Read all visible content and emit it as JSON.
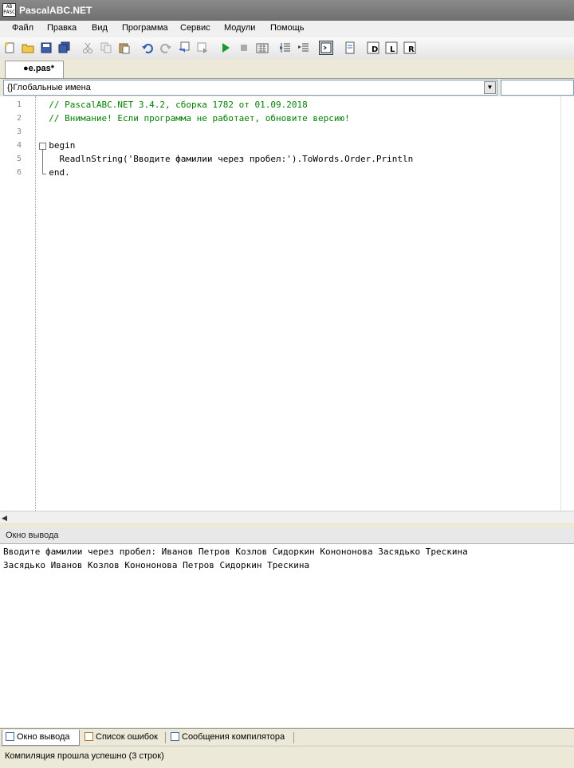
{
  "window": {
    "title": "PascalABC.NET",
    "icon_text": "AB PASC"
  },
  "menu": [
    "Файл",
    "Правка",
    "Вид",
    "Программа",
    "Сервис",
    "Модули",
    "Помощь"
  ],
  "tab": {
    "label": "●e.pas*"
  },
  "scope_selector": {
    "value": "{}Глобальные имена"
  },
  "editor": {
    "line_numbers": [
      "1",
      "2",
      "3",
      "4",
      "5",
      "6"
    ],
    "lines": [
      "  // PascalABC.NET 3.4.2, сборка 1782 от 01.09.2018",
      "  // Внимание! Если программа не работает, обновите версию!",
      "",
      "  begin",
      "    ReadlnString('Вводите фамилии через пробел:').ToWords.Order.Println",
      "  end."
    ]
  },
  "output_panel": {
    "title": "Окно вывода",
    "lines": [
      "Вводите фамилии через пробел: Иванов Петров Козлов Сидоркин Конононова Засядько Трескина",
      "Засядько Иванов Козлов Конононова Петров Сидоркин Трескина"
    ]
  },
  "bottom_tabs": [
    "Окно вывода",
    "Список ошибок",
    "Сообщения компилятора"
  ],
  "status": {
    "text": "Компиляция прошла успешно (3 строк)"
  },
  "colors": {
    "comment": "#008000",
    "title_bar": "#7a7a7a",
    "chrome": "#ece9d8"
  }
}
